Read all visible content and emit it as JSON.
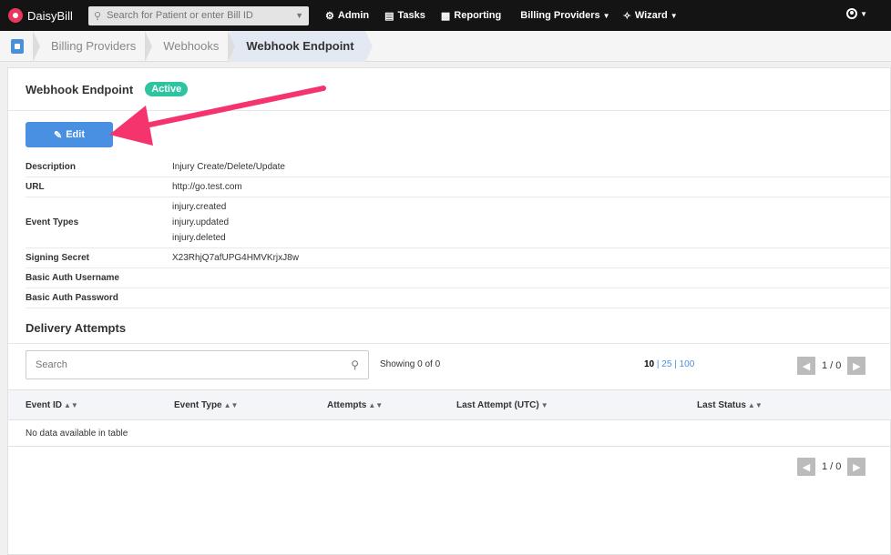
{
  "topnav": {
    "brand": "DaisyBill",
    "search_placeholder": "Search for Patient or enter Bill ID",
    "items": [
      {
        "label": "Admin",
        "icon": "gear-icon"
      },
      {
        "label": "Tasks",
        "icon": "clipboard-icon"
      },
      {
        "label": "Reporting",
        "icon": "bar-chart-icon"
      },
      {
        "label": "Billing Providers",
        "icon": "chevron-down-icon"
      },
      {
        "label": "Wizard",
        "icon": "wand-icon"
      }
    ]
  },
  "breadcrumb": {
    "items": [
      "Billing Providers",
      "Webhooks",
      "Webhook Endpoint"
    ]
  },
  "panel": {
    "title": "Webhook Endpoint",
    "status": "Active",
    "edit_label": "Edit"
  },
  "details": {
    "description_label": "Description",
    "description": "Injury Create/Delete/Update",
    "url_label": "URL",
    "url": "http://go.test.com",
    "event_types_label": "Event Types",
    "event_types": [
      "injury.created",
      "injury.updated",
      "injury.deleted"
    ],
    "signing_secret_label": "Signing Secret",
    "signing_secret": "X23RhjQ7afUPG4HMVKrjxJ8w",
    "basic_user_label": "Basic Auth Username",
    "basic_pass_label": "Basic Auth Password"
  },
  "delivery": {
    "title": "Delivery Attempts",
    "search_placeholder": "Search",
    "showing": "Showing 0 of 0",
    "page_sizes": [
      "10",
      "25",
      "100"
    ],
    "page_indicator": "1 / 0",
    "columns": [
      "Event ID",
      "Event Type",
      "Attempts",
      "Last Attempt (UTC)",
      "Last Status"
    ],
    "empty_text": "No data available in table"
  },
  "colors": {
    "accent": "#4a90e2",
    "active_badge": "#2ec4a0",
    "annotation_arrow": "#f5336c",
    "nav_bg": "#141414"
  }
}
